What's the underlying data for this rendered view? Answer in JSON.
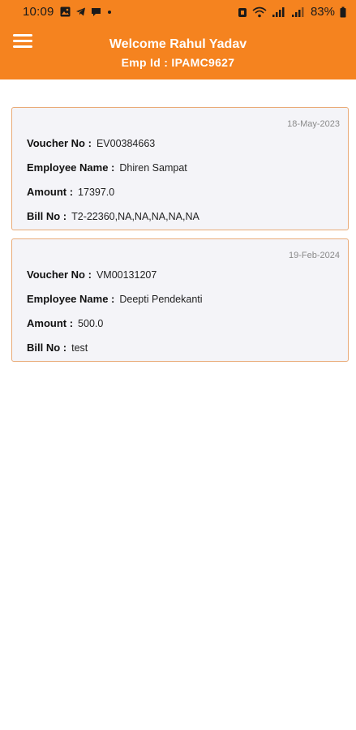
{
  "status_bar": {
    "time": "10:09",
    "battery": "83%",
    "icons": [
      "gallery-icon",
      "telegram-icon",
      "chat-bubble-icon",
      "dot-icon",
      "alarm-icon",
      "wifi-icon",
      "signal-icon",
      "signal-icon",
      "battery-icon"
    ]
  },
  "header": {
    "title": "Welcome Rahul Yadav",
    "subtitle": "Emp Id : IPAMC9627",
    "menu_icon": "hamburger-menu-icon",
    "background_color": "#f5831f"
  },
  "vouchers": [
    {
      "date": "18-May-2023",
      "voucher_label": "Voucher No :",
      "voucher_no": "EV00384663",
      "employee_label": "Employee Name :",
      "employee_name": "Dhiren Sampat",
      "amount_label": "Amount :",
      "amount": "17397.0",
      "bill_label": "Bill No :",
      "bill_no": "T2-22360,NA,NA,NA,NA,NA"
    },
    {
      "date": "19-Feb-2024",
      "voucher_label": "Voucher No :",
      "voucher_no": "VM00131207",
      "employee_label": "Employee Name :",
      "employee_name": "Deepti Pendekanti",
      "amount_label": "Amount :",
      "amount": "500.0",
      "bill_label": "Bill No :",
      "bill_no": "test"
    }
  ],
  "colors": {
    "accent": "#f5831f",
    "card_border": "#e9ab78",
    "card_background": "#f4f4f8"
  }
}
